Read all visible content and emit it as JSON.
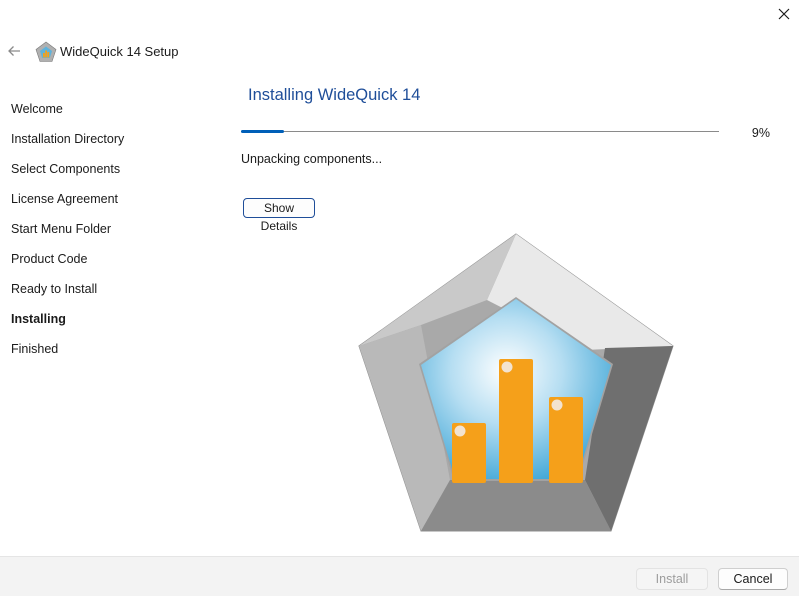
{
  "window": {
    "title": "WideQuick 14 Setup",
    "close_icon": "close-icon",
    "back_icon": "back-arrow-icon",
    "app_icon": "widequick-app-icon"
  },
  "sidebar": {
    "steps": [
      {
        "label": "Welcome",
        "active": false
      },
      {
        "label": "Installation Directory",
        "active": false
      },
      {
        "label": "Select Components",
        "active": false
      },
      {
        "label": "License Agreement",
        "active": false
      },
      {
        "label": "Start Menu Folder",
        "active": false
      },
      {
        "label": "Product Code",
        "active": false
      },
      {
        "label": "Ready to Install",
        "active": false
      },
      {
        "label": "Installing",
        "active": true
      },
      {
        "label": "Finished",
        "active": false
      }
    ]
  },
  "main": {
    "title": "Installing WideQuick 14",
    "progress": {
      "percent_label": "9%",
      "fraction": 0.09
    },
    "status": "Unpacking components...",
    "details_button": "Show Details",
    "illustration_icon": "widequick-logo-icon"
  },
  "footer": {
    "install_label": "Install",
    "install_enabled": false,
    "cancel_label": "Cancel"
  },
  "colors": {
    "title_blue": "#1f4e99",
    "progress_blue": "#005fb8",
    "logo_orange": "#f5a01a",
    "logo_sky": "#4aaed8"
  }
}
